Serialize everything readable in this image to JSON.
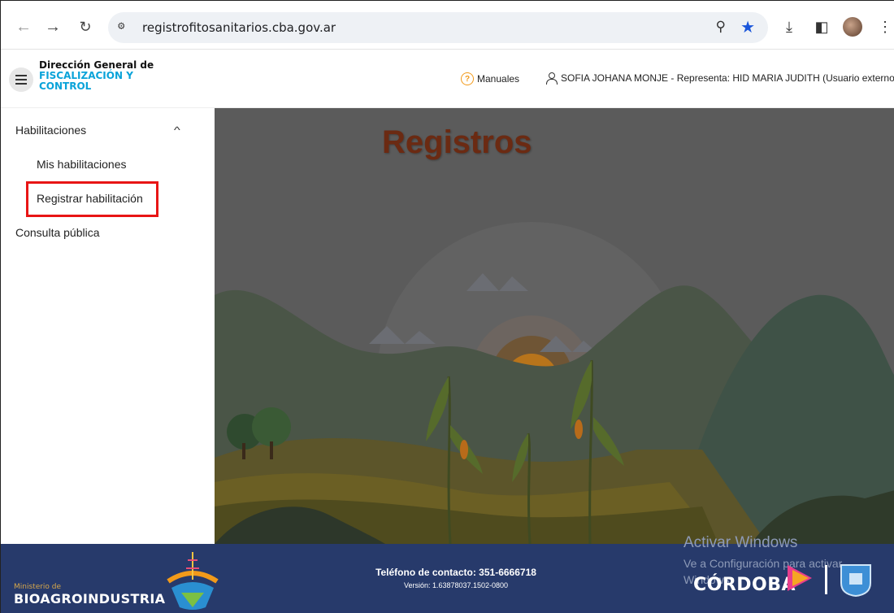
{
  "browser": {
    "url": "registrofitosanitarios.cba.gov.ar"
  },
  "header": {
    "brand_line1": "Dirección General de",
    "brand_line2": "FISCALIZACIÓN Y",
    "brand_line3": "CONTROL",
    "manuales_label": "Manuales",
    "user_label": "SOFIA JOHANA MONJE - Representa: HID MARIA JUDITH (Usuario externo)"
  },
  "sidebar": {
    "items": [
      {
        "label": "Habilitaciones"
      },
      {
        "label": "Mis habilitaciones"
      },
      {
        "label": "Registrar habilitación"
      },
      {
        "label": "Consulta pública"
      }
    ]
  },
  "main": {
    "title": "Registros"
  },
  "footer": {
    "ministry_small": "Ministerio de",
    "ministry_big": "BIOAGROINDUSTRIA",
    "phone": "Teléfono de contacto: 351-6666718",
    "version": "Versión: 1.63878037.1502-0800",
    "province": "CÓRDOBA"
  },
  "watermark": {
    "line1": "Activar Windows",
    "line2": "Ve a Configuración para activar",
    "line3": "Windows."
  },
  "colors": {
    "highlight": "#e81515",
    "footer_bg": "#273a6b",
    "brand_accent": "#0aa3d9"
  }
}
